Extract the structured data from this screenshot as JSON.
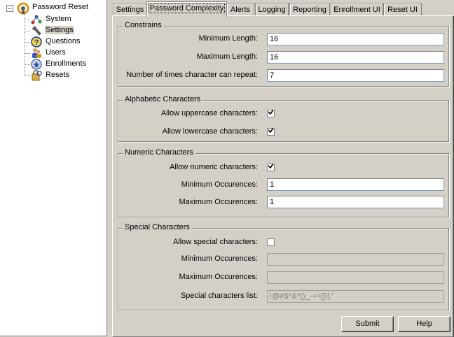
{
  "tree": {
    "root": {
      "label": "Password Reset",
      "expander": "−",
      "icon": "password-reset-icon"
    },
    "items": [
      {
        "label": "System",
        "icon": "network-icon",
        "selected": false
      },
      {
        "label": "Settings",
        "icon": "wrench-icon",
        "selected": true
      },
      {
        "label": "Questions",
        "icon": "question-icon",
        "selected": false
      },
      {
        "label": "Users",
        "icon": "users-icon",
        "selected": false
      },
      {
        "label": "Enrollments",
        "icon": "enrollment-icon",
        "selected": false
      },
      {
        "label": "Resets",
        "icon": "reset-icon",
        "selected": false
      }
    ]
  },
  "tabs": [
    {
      "label": "Settings",
      "active": false
    },
    {
      "label": "Password Complexity",
      "active": true
    },
    {
      "label": "Alerts",
      "active": false
    },
    {
      "label": "Logging",
      "active": false
    },
    {
      "label": "Reporting",
      "active": false
    },
    {
      "label": "Enrollment UI",
      "active": false
    },
    {
      "label": "Reset UI",
      "active": false
    }
  ],
  "constrains": {
    "title": "Constrains",
    "min_length_label": "Minimum Length:",
    "min_length_value": "16",
    "max_length_label": "Maximum Length:",
    "max_length_value": "16",
    "repeat_label": "Number of times character can repeat:",
    "repeat_value": "7"
  },
  "alphabetic": {
    "title": "Alphabetic Characters",
    "uppercase_label": "Allow uppercase characters:",
    "uppercase_checked": true,
    "lowercase_label": "Allow lowercase characters:",
    "lowercase_checked": true
  },
  "numeric": {
    "title": "Numeric Characters",
    "allow_label": "Allow numeric characters:",
    "allow_checked": true,
    "min_label": "Minimum Occurences:",
    "min_value": "1",
    "max_label": "Maximum Occurences:",
    "max_value": "1"
  },
  "special": {
    "title": "Special Characters",
    "allow_label": "Allow special characters:",
    "allow_checked": false,
    "min_label": "Minimum Occurences:",
    "min_value": "",
    "max_label": "Maximum Occurences:",
    "max_value": "",
    "list_label": "Special characters list:",
    "list_value": "!@#$^&*()_-+=[]\\|,'"
  },
  "buttons": {
    "submit": "Submit",
    "help": "Help"
  }
}
